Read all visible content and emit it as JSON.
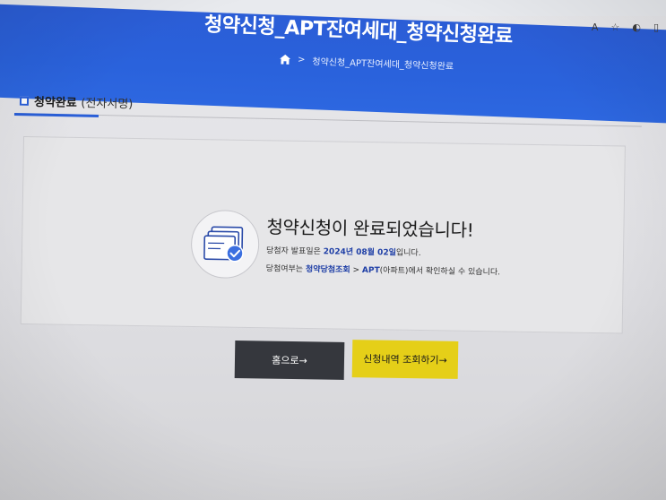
{
  "browser": {
    "icons": [
      "read-aloud-icon",
      "favorite-star-icon",
      "extension-icon",
      "collections-icon"
    ],
    "read_aloud_label": "A",
    "star_glyph": "☆",
    "ext_glyph": "◐",
    "col_glyph": "▯"
  },
  "header": {
    "title": "청약신청_APT잔여세대_청약신청완료",
    "breadcrumb_sep": ">",
    "breadcrumb_current": "청약신청_APT잔여세대_청약신청완료"
  },
  "section": {
    "title": "청약완료",
    "subtitle": "(전자서명)"
  },
  "message": {
    "title": "청약신청이 완료되었습니다!",
    "line1_prefix": "당첨자 발표일은 ",
    "line1_date": "2024년 08월 02일",
    "line1_suffix": "입니다.",
    "line2_prefix": "당첨여부는 ",
    "line2_link1": "청약당첨조회",
    "line2_sep": " > ",
    "line2_link2": "APT",
    "line2_paren": "(아파트)",
    "line2_suffix": "에서 확인하실 수 있습니다."
  },
  "buttons": {
    "home_label": "홈으로→",
    "view_label": "신청내역 조회하기→"
  },
  "colors": {
    "header_blue": "#2a62dc",
    "accent_blue": "#2a5fd8",
    "home_button": "#35373d",
    "view_button": "#e5cf18"
  }
}
